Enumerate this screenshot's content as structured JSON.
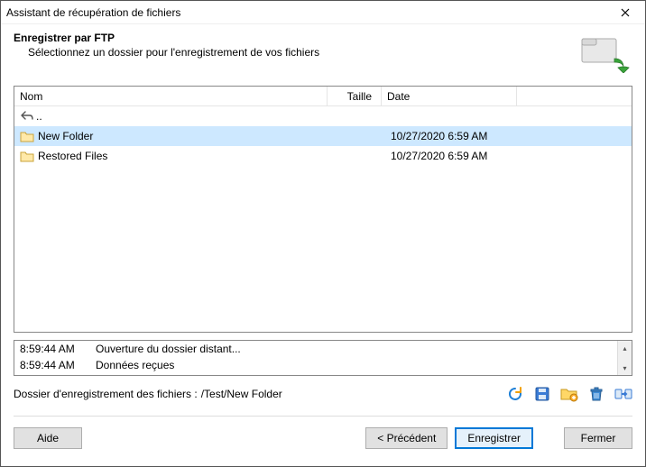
{
  "window": {
    "title": "Assistant de récupération de fichiers"
  },
  "header": {
    "title": "Enregistrer par FTP",
    "subtitle": "Sélectionnez un dossier pour l'enregistrement de vos fichiers"
  },
  "columns": {
    "name": "Nom",
    "size": "Taille",
    "date": "Date"
  },
  "uprow": {
    "label": ".."
  },
  "rows": [
    {
      "name": "New Folder",
      "size": "",
      "date": "10/27/2020 6:59 AM",
      "selected": true
    },
    {
      "name": "Restored Files",
      "size": "",
      "date": "10/27/2020 6:59 AM",
      "selected": false
    }
  ],
  "log": [
    {
      "time": "8:59:44 AM",
      "msg": "Ouverture du dossier distant..."
    },
    {
      "time": "8:59:44 AM",
      "msg": "Données reçues"
    }
  ],
  "pathrow": {
    "label": "Dossier d'enregistrement des fichiers :",
    "path": "/Test/New Folder"
  },
  "icons": {
    "refresh": "refresh-icon",
    "save": "save-icon",
    "newfolder": "new-folder-icon",
    "delete": "delete-icon",
    "transfer": "transfer-icon"
  },
  "footer": {
    "help": "Aide",
    "prev": "< Précédent",
    "save": "Enregistrer",
    "close": "Fermer"
  }
}
